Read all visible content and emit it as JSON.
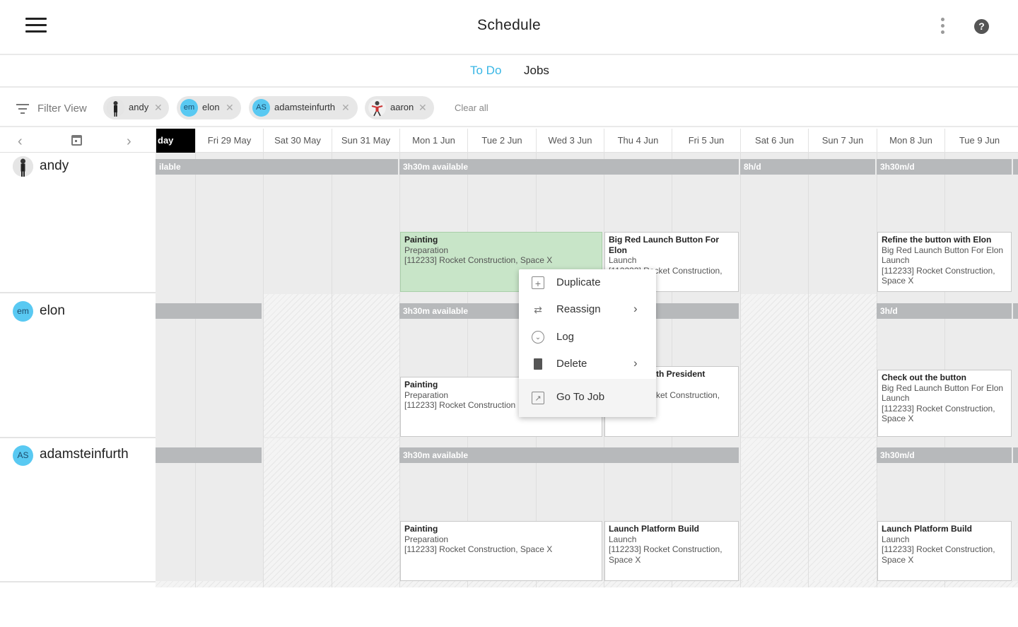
{
  "header": {
    "title": "Schedule"
  },
  "tabs": [
    {
      "label": "To Do",
      "active": true
    },
    {
      "label": "Jobs",
      "active": false
    }
  ],
  "filter": {
    "label": "Filter View",
    "chips": [
      {
        "label": "andy",
        "avatar": "photo"
      },
      {
        "label": "elon",
        "avatar": "em"
      },
      {
        "label": "adamsteinfurth",
        "avatar": "AS"
      },
      {
        "label": "aaron",
        "avatar": "photo"
      }
    ],
    "clear_label": "Clear all"
  },
  "dates": [
    "day",
    "Fri 29 May",
    "Sat 30 May",
    "Sun 31 May",
    "Mon 1 Jun",
    "Tue 2 Jun",
    "Wed 3 Jun",
    "Thu 4 Jun",
    "Fri 5 Jun",
    "Sat 6 Jun",
    "Sun 7 Jun",
    "Mon 8 Jun",
    "Tue 9 Jun"
  ],
  "rows": [
    {
      "name": "andy",
      "avatar": "photo",
      "availability": [
        "ilable",
        "3h30m available",
        "8h/d",
        "3h30m/d"
      ],
      "cards": [
        {
          "title": "Painting",
          "lines": [
            "Preparation",
            "[112233] Rocket Construction, Space X"
          ],
          "selected": true
        },
        {
          "title": "Big Red Launch Button For Elon",
          "lines": [
            "Launch",
            "[112233] Rocket Construction,"
          ]
        },
        {
          "title": "Refine the button with Elon",
          "lines": [
            "Big Red Launch Button For Elon",
            "Launch",
            "[112233] Rocket Construction,",
            "Space X"
          ]
        }
      ]
    },
    {
      "name": "elon",
      "avatar": "em",
      "availability": [
        "3h30m available",
        "3h/d"
      ],
      "cards": [
        {
          "title": "Painting",
          "lines": [
            "Preparation",
            "[112233] Rocket Construction"
          ]
        },
        {
          "title": "th President",
          "lines": [
            "ket Construction,"
          ]
        },
        {
          "title": "Check out the button",
          "lines": [
            "Big Red Launch Button For Elon",
            "Launch",
            "[112233] Rocket Construction,",
            "Space X"
          ]
        }
      ]
    },
    {
      "name": "adamsteinfurth",
      "avatar": "AS",
      "availability": [
        "3h30m available",
        "3h30m/d"
      ],
      "cards": [
        {
          "title": "Painting",
          "lines": [
            "Preparation",
            "[112233] Rocket Construction, Space X"
          ]
        },
        {
          "title": "Launch Platform Build",
          "lines": [
            "Launch",
            "[112233] Rocket Construction,",
            "Space X"
          ]
        },
        {
          "title": "Launch Platform Build",
          "lines": [
            "Launch",
            "[112233] Rocket Construction,",
            "Space X"
          ]
        }
      ]
    }
  ],
  "context_menu": [
    {
      "label": "Duplicate",
      "icon": "duplicate-icon"
    },
    {
      "label": "Reassign",
      "icon": "reassign-icon",
      "submenu": true
    },
    {
      "label": "Log",
      "icon": "log-icon"
    },
    {
      "label": "Delete",
      "icon": "trash-icon",
      "submenu": true
    },
    {
      "label": "Go To Job",
      "icon": "external-link-icon"
    }
  ]
}
